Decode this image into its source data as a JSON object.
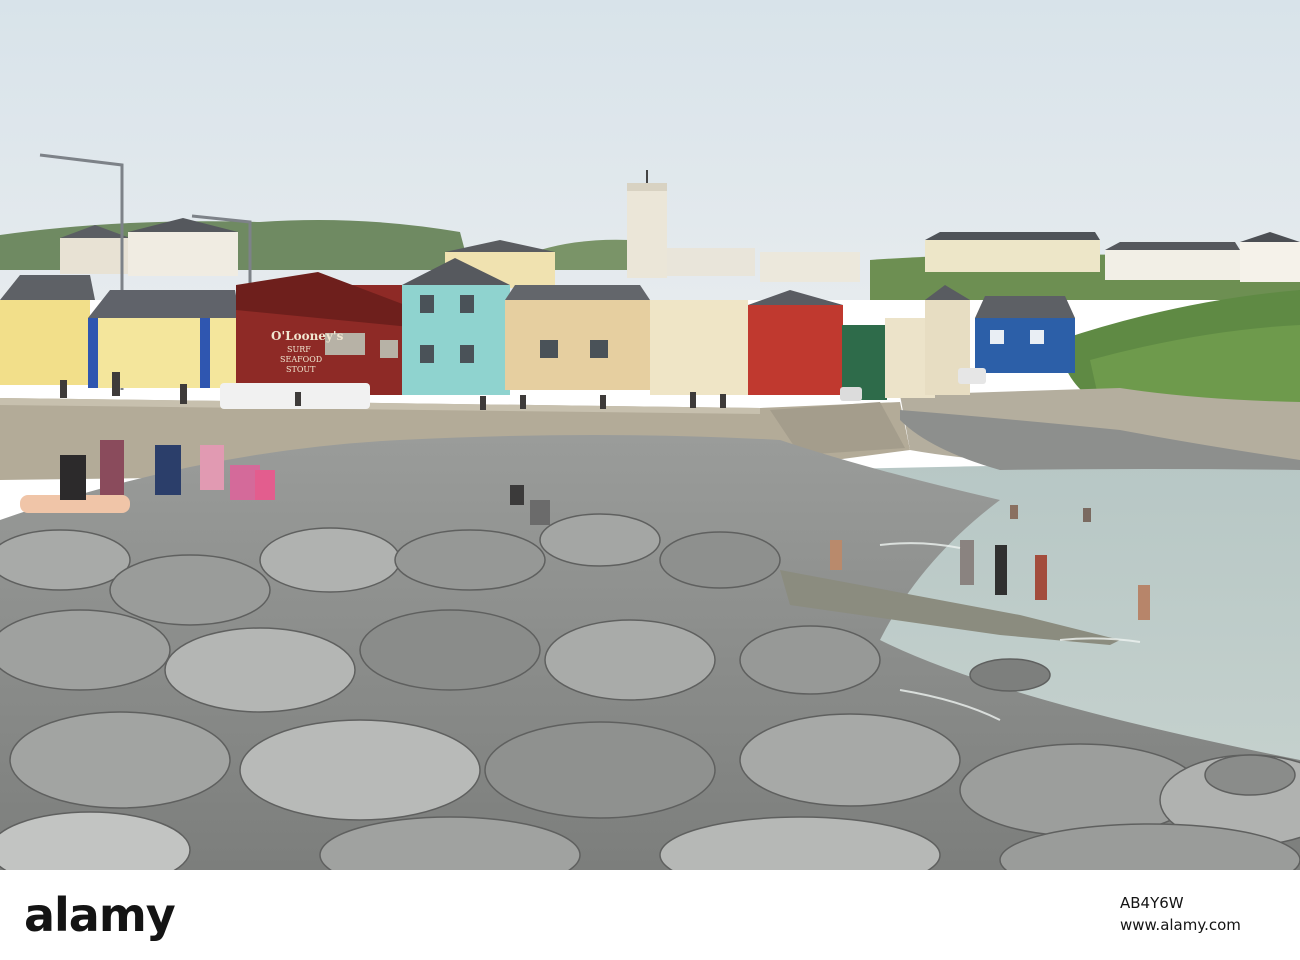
{
  "scene": {
    "description_free": true,
    "pub_sign": {
      "line1": "O'Looney's",
      "line2": "SURF",
      "line3": "SEAFOOD",
      "line4": "STOUT"
    }
  },
  "footer": {
    "logo": "alamy",
    "image_id": "AB4Y6W",
    "url": "www.alamy.com"
  },
  "colors": {
    "sky": "#dde6ec",
    "sea": "#b9c8c6",
    "rock": "#8a8c8a",
    "pub_red": "#8e2a26",
    "house_cyan": "#8fd3cf",
    "house_blue": "#2c5fa8",
    "hill_green": "#5f8a44"
  }
}
